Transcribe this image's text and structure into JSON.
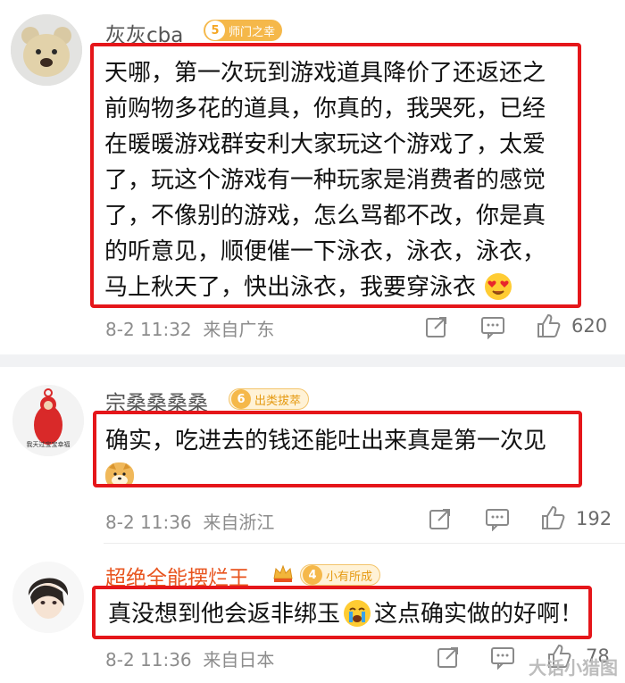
{
  "comments": [
    {
      "username": "灰灰cba",
      "badge_level": "5",
      "badge_text": "师门之幸",
      "text_lines": [
        "天哪，第一次玩到游戏道具降价了还返还之",
        "前购物多花的道具，你真的，我哭死，已经",
        "在暖暖游戏群安利大家玩这个游戏了，太爱",
        "了，玩这个游戏有一种玩家是消费者的感觉",
        "了，不像别的游戏，怎么骂都不改，你是真",
        "的听意见，顺便催一下泳衣，泳衣，泳衣，",
        "马上秋天了，快出泳衣，我要穿泳衣"
      ],
      "emoji": "heart-eyes-emoji",
      "time": "8-2 11:32",
      "location": "来自广东",
      "likes": "620"
    },
    {
      "username": "宗桑桑桑桑",
      "badge_level": "6",
      "badge_text": "出类拔萃",
      "avatar_caption": "我天过宝宝幸福",
      "text_lines": [
        "确实，吃进去的钱还能吐出来真是第一次见"
      ],
      "emoji": "doge-emoji",
      "time": "8-2 11:36",
      "location": "来自浙江",
      "likes": "192"
    },
    {
      "username": "超绝全能摆烂王",
      "badge_level": "4",
      "badge_text": "小有所成",
      "text_before": "真没想到他会返非绑玉",
      "text_after": "这点确实做的好啊！",
      "emoji": "crying-emoji",
      "time": "8-2 11:36",
      "location": "来自日本",
      "likes": "78"
    }
  ],
  "watermark": "大话小猎图",
  "colors": {
    "highlight_border": "#e5161a",
    "username": "#555555",
    "vip_username": "#e8541e",
    "meta": "#8c8c8c"
  },
  "icons": [
    "share-icon",
    "comment-icon",
    "like-icon",
    "crown-icon"
  ]
}
